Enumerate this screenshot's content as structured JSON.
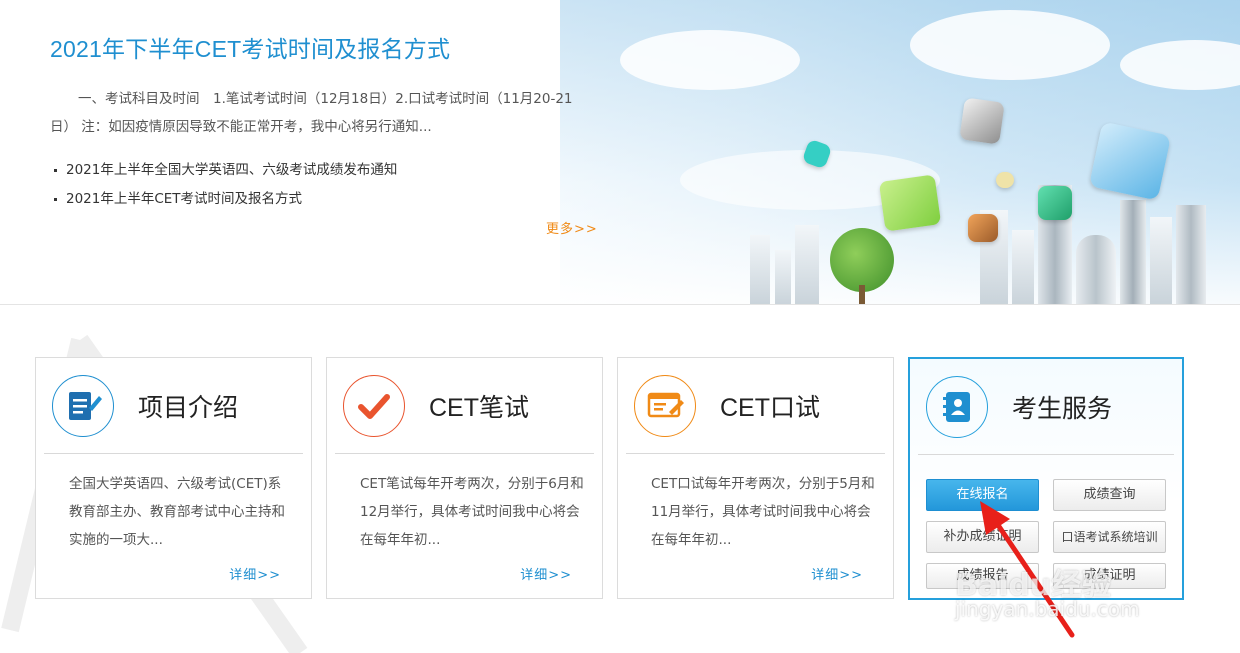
{
  "hero": {
    "title": "2021年下半年CET考试时间及报名方式",
    "summary": "一、考试科目及时间　1.笔试考试时间（12月18日）2.口试考试时间（11月20-21日） 注：如因疫情原因导致不能正常开考，我中心将另行通知...",
    "news": [
      "2021年上半年全国大学英语四、六级考试成绩发布通知",
      "2021年上半年CET考试时间及报名方式"
    ],
    "more_label": "更多>>"
  },
  "cards": [
    {
      "title": "项目介绍",
      "icon": "document-edit-icon",
      "desc": "全国大学英语四、六级考试(CET)系教育部主办、教育部考试中心主持和实施的一项大...",
      "detail": "详细>>"
    },
    {
      "title": "CET笔试",
      "icon": "check-icon",
      "desc": "CET笔试每年开考两次，分别于6月和12月举行，具体考试时间我中心将会在每年年初...",
      "detail": "详细>>"
    },
    {
      "title": "CET口试",
      "icon": "screen-edit-icon",
      "desc": "CET口试每年开考两次，分别于5月和11月举行，具体考试时间我中心将会在每年年初...",
      "detail": "详细>>"
    },
    {
      "title": "考生服务",
      "icon": "address-book-icon",
      "buttons": [
        "在线报名",
        "成绩查询",
        "补办成绩证明",
        "口语考试系统培训",
        "成绩报告",
        "成绩证明"
      ]
    }
  ],
  "colors": {
    "accent": "#1f8fd0",
    "more": "#f08a16",
    "check": "#e9542e",
    "screen": "#f08a16",
    "active_border": "#25a0dc"
  },
  "watermark": {
    "brand": "Baidu经验",
    "url": "jingyan.baidu.com"
  }
}
